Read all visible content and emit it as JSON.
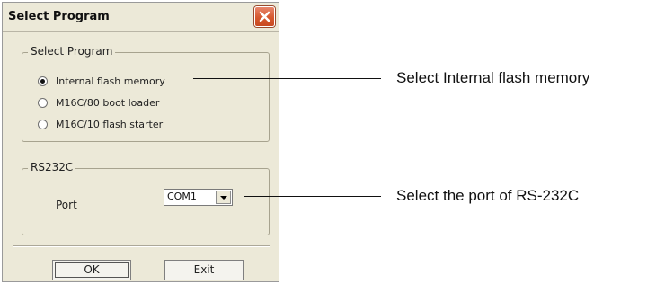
{
  "dialog": {
    "title": "Select Program",
    "select_program_group": {
      "legend": "Select Program",
      "options": [
        {
          "label": "Internal flash memory",
          "checked": true
        },
        {
          "label": "M16C/80 boot loader",
          "checked": false
        },
        {
          "label": "M16C/10 flash starter",
          "checked": false
        }
      ]
    },
    "rs232c_group": {
      "legend": "RS232C",
      "port_label": "Port",
      "port_value": "COM1"
    },
    "buttons": {
      "ok": "OK",
      "exit": "Exit"
    }
  },
  "callouts": {
    "flash": "Select Internal flash memory",
    "port": "Select the port of RS-232C"
  },
  "colors": {
    "dialog_bg": "#ece9d8",
    "close_button": "#d6582e"
  }
}
